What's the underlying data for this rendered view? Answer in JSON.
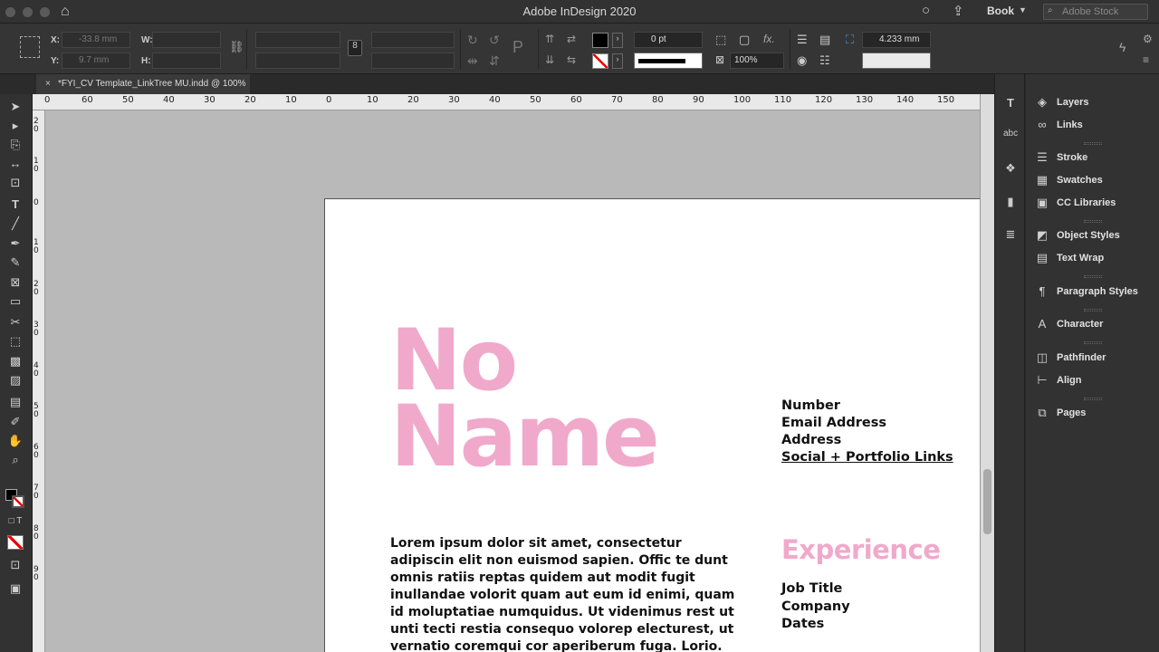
{
  "window": {
    "title": "Adobe InDesign 2020",
    "workspace": "Book",
    "stock_search_placeholder": "Adobe Stock"
  },
  "control": {
    "x_label": "X:",
    "x_value": "-33.8 mm",
    "y_label": "Y:",
    "y_value": "9.7 mm",
    "w_label": "W:",
    "h_label": "H:",
    "stroke_weight": "0 pt",
    "opacity": "100%",
    "gap": "4.233 mm",
    "fx_label": "fx."
  },
  "tab": {
    "title": "*FYI_CV Template_LinkTree MU.indd @ 100%",
    "close": "×"
  },
  "ruler": {
    "h_labels": [
      "0",
      "60",
      "50",
      "40",
      "30",
      "20",
      "10",
      "0",
      "10",
      "20",
      "30",
      "40",
      "50",
      "60",
      "70",
      "80",
      "90",
      "100",
      "110",
      "120",
      "130",
      "140",
      "150"
    ],
    "v_labels": [
      "2 0",
      "1 0",
      "0",
      "1 0",
      "2 0",
      "3 0",
      "4 0",
      "5 0",
      "6 0",
      "7 0",
      "8 0",
      "9 0"
    ]
  },
  "document": {
    "name_line1": "No",
    "name_line2": "Name",
    "contact": [
      "Number",
      "Email Address",
      "Address",
      "Social + Portfolio Links"
    ],
    "experience_heading": "Experience",
    "experience_items": [
      "Job Title",
      "Company",
      "Dates"
    ],
    "bio_lines": [
      "Lorem ipsum dolor sit amet, consectetur",
      "adipiscin elit non euismod sapien. Offic te dunt",
      "omnis ratiis reptas quidem aut modit fugit",
      "inullandae volorit quam aut eum id enimi, quam",
      "id moluptatiae numquidus. Ut videnimus rest ut",
      "unti tecti restia consequo volorep electurest, ut",
      "vernatio coremqui cor aperiberum fuga. Lorio."
    ]
  },
  "panels": [
    {
      "name": "layers",
      "label": "Layers",
      "icon": "layers-icon",
      "glyph": "◈"
    },
    {
      "name": "links",
      "label": "Links",
      "icon": "links-icon",
      "glyph": "∞"
    },
    {
      "name": "stroke",
      "label": "Stroke",
      "icon": "stroke-icon",
      "glyph": "☰"
    },
    {
      "name": "swatches",
      "label": "Swatches",
      "icon": "swatches-icon",
      "glyph": "▦"
    },
    {
      "name": "cc-libraries",
      "label": "CC Libraries",
      "icon": "cc-libraries-icon",
      "glyph": "▣"
    },
    {
      "name": "object-styles",
      "label": "Object Styles",
      "icon": "object-styles-icon",
      "glyph": "◩"
    },
    {
      "name": "text-wrap",
      "label": "Text Wrap",
      "icon": "text-wrap-icon",
      "glyph": "▤"
    },
    {
      "name": "paragraph-styles",
      "label": "Paragraph Styles",
      "icon": "paragraph-styles-icon",
      "glyph": "¶"
    },
    {
      "name": "character",
      "label": "Character",
      "icon": "character-icon",
      "glyph": "A"
    },
    {
      "name": "pathfinder",
      "label": "Pathfinder",
      "icon": "pathfinder-icon",
      "glyph": "◫"
    },
    {
      "name": "align",
      "label": "Align",
      "icon": "align-icon",
      "glyph": "⊢"
    },
    {
      "name": "pages",
      "label": "Pages",
      "icon": "pages-icon",
      "glyph": "⧉"
    }
  ],
  "colors": {
    "accent_pink": "#f0a9cb",
    "ui_dark": "#323232",
    "pasteboard": "#b9b9b9"
  }
}
